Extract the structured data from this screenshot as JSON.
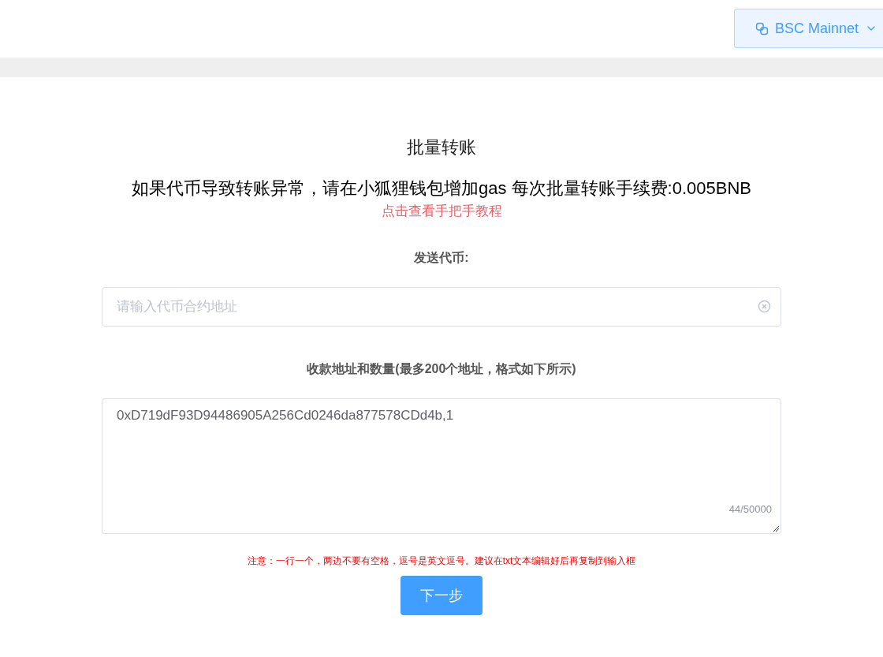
{
  "network_selector": {
    "label": "BSC Mainnet"
  },
  "title": "批量转账",
  "subtitle": "如果代币导致转账异常，请在小狐狸钱包增加gas 每次批量转账手续费:0.005BNB",
  "tutorial_link": "点击查看手把手教程",
  "token_label": "发送代币:",
  "token_field": {
    "placeholder": "请输入代币合约地址"
  },
  "recipients_label": "收款地址和数量(最多200个地址，格式如下所示)",
  "recipients_field": {
    "value": "0xD719dF93D94486905A256Cd0246da877578CDd4b,1",
    "counter": "44/50000"
  },
  "note": "注意：一行一个，两边不要有空格，逗号是英文逗号。建议在txt文本编辑好后再复制到输入框",
  "next_button": "下一步"
}
